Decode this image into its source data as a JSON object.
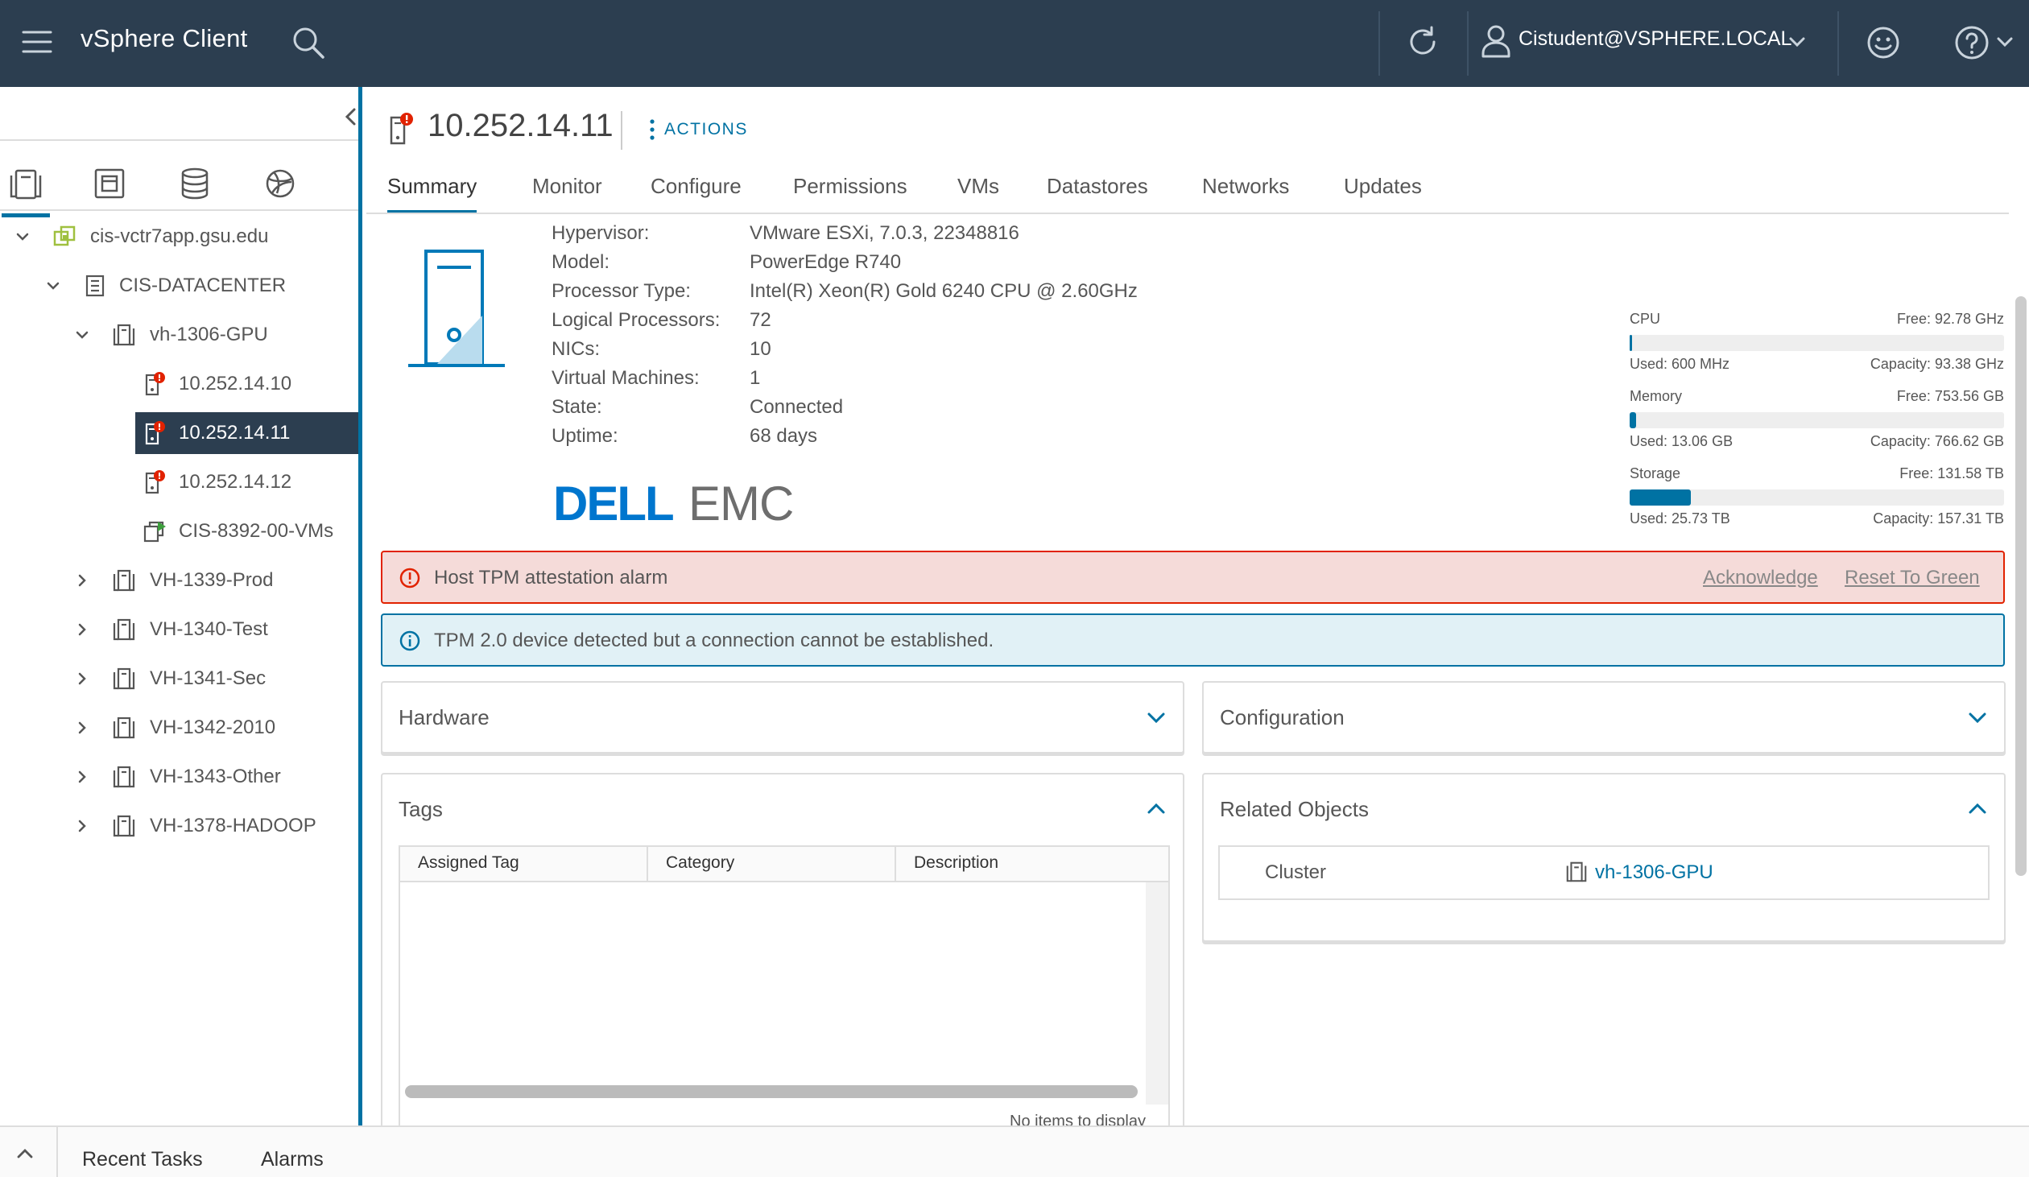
{
  "header": {
    "title": "vSphere Client",
    "user": "Cistudent@VSPHERE.LOCAL"
  },
  "sidebar": {
    "tree": [
      {
        "label": "cis-vctr7app.gsu.edu",
        "icon": "vcenter-icon",
        "expanded": true
      },
      {
        "label": "CIS-DATACENTER",
        "icon": "datacenter-icon",
        "expanded": true
      },
      {
        "label": "vh-1306-GPU",
        "icon": "cluster-icon",
        "expanded": true
      },
      {
        "label": "10.252.14.10",
        "icon": "host-alarm-icon"
      },
      {
        "label": "10.252.14.11",
        "icon": "host-alarm-icon",
        "selected": true
      },
      {
        "label": "10.252.14.12",
        "icon": "host-alarm-icon"
      },
      {
        "label": "CIS-8392-00-VMs",
        "icon": "resource-pool-icon"
      },
      {
        "label": "VH-1339-Prod",
        "icon": "cluster-icon",
        "expanded": false
      },
      {
        "label": "VH-1340-Test",
        "icon": "cluster-icon",
        "expanded": false
      },
      {
        "label": "VH-1341-Sec",
        "icon": "cluster-icon",
        "expanded": false
      },
      {
        "label": "VH-1342-2010",
        "icon": "cluster-icon",
        "expanded": false
      },
      {
        "label": "VH-1343-Other",
        "icon": "cluster-icon",
        "expanded": false
      },
      {
        "label": "VH-1378-HADOOP",
        "icon": "cluster-icon",
        "expanded": false
      }
    ]
  },
  "object": {
    "title": "10.252.14.11",
    "actions": "ACTIONS"
  },
  "tabs": [
    "Summary",
    "Monitor",
    "Configure",
    "Permissions",
    "VMs",
    "Datastores",
    "Networks",
    "Updates"
  ],
  "summary": {
    "props": [
      {
        "k": "Hypervisor:",
        "v": "VMware ESXi, 7.0.3, 22348816"
      },
      {
        "k": "Model:",
        "v": "PowerEdge R740"
      },
      {
        "k": "Processor Type:",
        "v": "Intel(R) Xeon(R) Gold 6240 CPU @ 2.60GHz"
      },
      {
        "k": "Logical Processors:",
        "v": "72"
      },
      {
        "k": "NICs:",
        "v": "10"
      },
      {
        "k": "Virtual Machines:",
        "v": "1"
      },
      {
        "k": "State:",
        "v": "Connected"
      },
      {
        "k": "Uptime:",
        "v": "68 days"
      }
    ],
    "vendor_logo": "DELLEMC",
    "resources": [
      {
        "name": "CPU",
        "free": "Free: 92.78 GHz",
        "used": "Used: 600 MHz",
        "capacity": "Capacity: 93.38 GHz",
        "used_fraction": 0.006
      },
      {
        "name": "Memory",
        "free": "Free: 753.56 GB",
        "used": "Used: 13.06 GB",
        "capacity": "Capacity: 766.62 GB",
        "used_fraction": 0.017
      },
      {
        "name": "Storage",
        "free": "Free: 131.58 TB",
        "used": "Used: 25.73 TB",
        "capacity": "Capacity: 157.31 TB",
        "used_fraction": 0.164
      }
    ]
  },
  "alerts": {
    "alarm": {
      "text": "Host TPM attestation alarm",
      "acknowledge": "Acknowledge",
      "reset": "Reset To Green",
      "color": "#e12200"
    },
    "info": {
      "text": "TPM 2.0 device detected but a connection cannot be established.",
      "color": "#0072a3"
    }
  },
  "cards": {
    "hardware": "Hardware",
    "configuration": "Configuration",
    "tags": {
      "title": "Tags",
      "columns": [
        "Assigned Tag",
        "Category",
        "Description"
      ],
      "rows": [],
      "empty": "No items to display"
    },
    "related": {
      "title": "Related Objects",
      "rows": [
        {
          "k": "Cluster",
          "v": "vh-1306-GPU"
        }
      ]
    }
  },
  "bottom": {
    "tabs": [
      "Recent Tasks",
      "Alarms"
    ]
  },
  "colors": {
    "header_bg": "#2c3e50",
    "accent": "#0072a3",
    "alarm": "#e12200"
  }
}
